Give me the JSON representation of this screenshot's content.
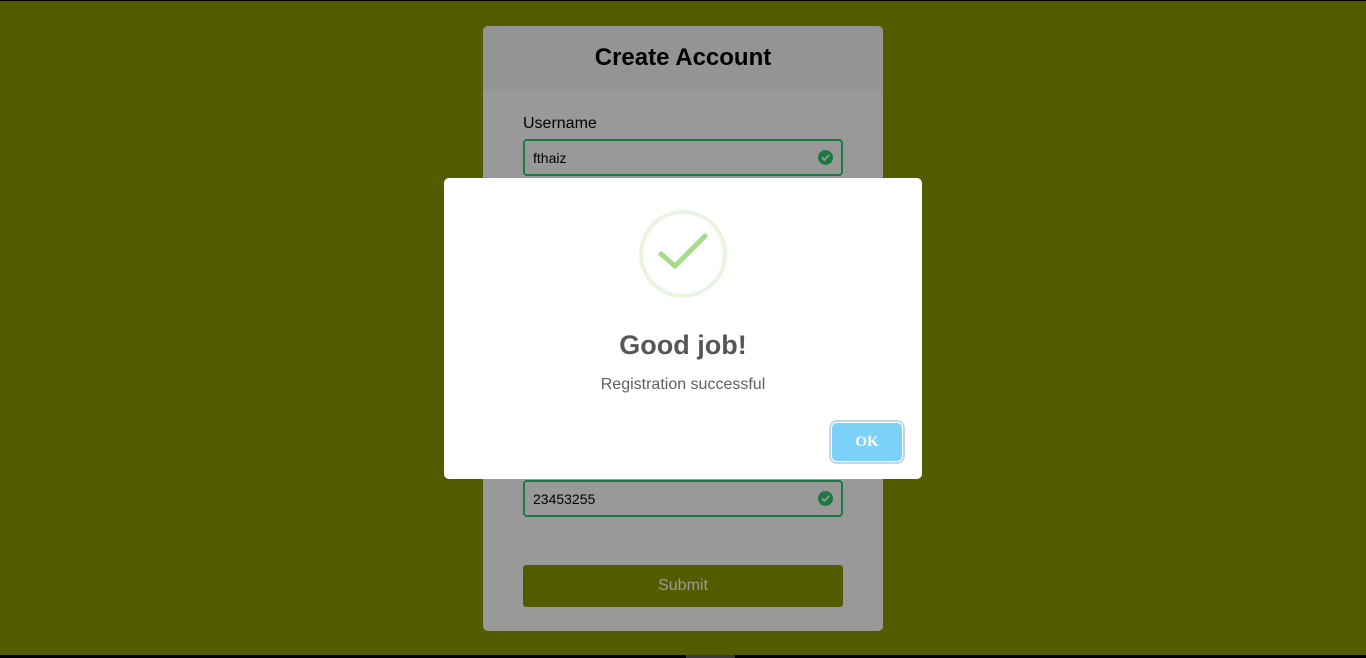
{
  "form": {
    "title": "Create Account",
    "username_label": "Username",
    "username_value": "fthaiz",
    "phone_value": "23453255",
    "submit_label": "Submit"
  },
  "dialog": {
    "title": "Good job!",
    "message": "Registration successful",
    "ok_label": "OK",
    "icon": "success-check-icon"
  },
  "colors": {
    "page_background": "#8c9900",
    "valid_border": "#2ecc71",
    "ok_button": "#7cd1f9",
    "check": "#a5dc86"
  }
}
